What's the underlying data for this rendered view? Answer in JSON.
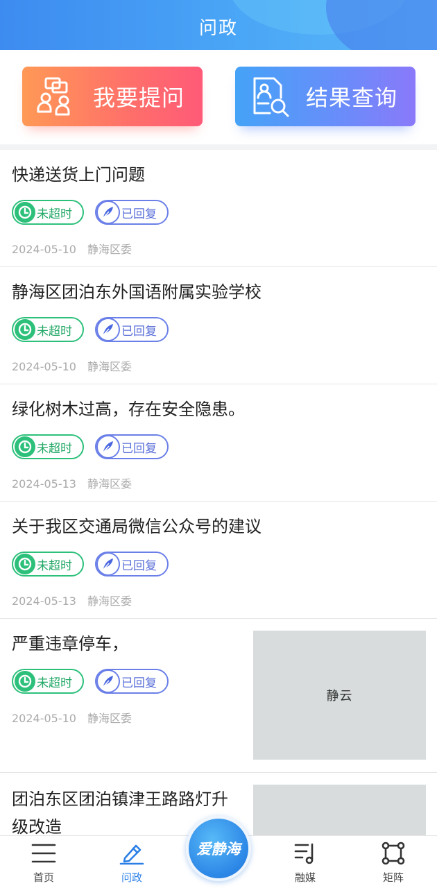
{
  "header": {
    "title": "问政"
  },
  "actions": {
    "ask_label": "我要提问",
    "query_label": "结果查询"
  },
  "items": [
    {
      "title": "快递送货上门问题",
      "time_status": "未超时",
      "reply_status": "已回复",
      "date": "2024-05-10",
      "dept": "静海区委"
    },
    {
      "title": "静海区团泊东外国语附属实验学校",
      "time_status": "未超时",
      "reply_status": "已回复",
      "date": "2024-05-10",
      "dept": "静海区委"
    },
    {
      "title": "绿化树木过高，存在安全隐患。",
      "time_status": "未超时",
      "reply_status": "已回复",
      "date": "2024-05-13",
      "dept": "静海区委"
    },
    {
      "title": "关于我区交通局微信公众号的建议",
      "time_status": "未超时",
      "reply_status": "已回复",
      "date": "2024-05-13",
      "dept": "静海区委"
    },
    {
      "title": "严重违章停车，",
      "time_status": "未超时",
      "reply_status": "已回复",
      "date": "2024-05-10",
      "dept": "静海区委",
      "thumb_text": "静云"
    },
    {
      "title_line1": "团泊东区团泊镇津王路路灯升",
      "title_line2": "级改造"
    }
  ],
  "nav": {
    "home": "首页",
    "wenzheng": "问政",
    "center": "爱静海",
    "media": "融媒",
    "matrix": "矩阵"
  },
  "colors": {
    "accent": "#2a7fe6",
    "time_badge": "#2cc07a",
    "reply_badge": "#6a7fe8"
  }
}
